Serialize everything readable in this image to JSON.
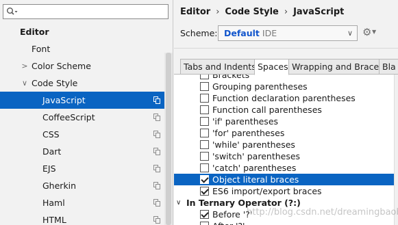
{
  "search": {
    "value": "",
    "icon": "search-dropdown-icon"
  },
  "tree": [
    {
      "label": "Editor",
      "level": 0,
      "bold": true
    },
    {
      "label": "Font",
      "level": 1
    },
    {
      "label": "Color Scheme",
      "level": 1,
      "arrow": ">"
    },
    {
      "label": "Code Style",
      "level": 1,
      "arrow": "∨"
    },
    {
      "label": "JavaScript",
      "level": 2,
      "selected": true,
      "copy_icon": true
    },
    {
      "label": "CoffeeScript",
      "level": 2,
      "copy_icon": true
    },
    {
      "label": "CSS",
      "level": 2,
      "copy_icon": true
    },
    {
      "label": "Dart",
      "level": 2,
      "copy_icon": true
    },
    {
      "label": "EJS",
      "level": 2,
      "copy_icon": true
    },
    {
      "label": "Gherkin",
      "level": 2,
      "copy_icon": true
    },
    {
      "label": "Haml",
      "level": 2,
      "copy_icon": true
    },
    {
      "label": "HTML",
      "level": 2,
      "copy_icon": true
    }
  ],
  "breadcrumb": {
    "items": [
      "Editor",
      "Code Style",
      "JavaScript"
    ],
    "separator": "›"
  },
  "scheme": {
    "label": "Scheme:",
    "name": "Default",
    "tag": "IDE",
    "chevron": "∨"
  },
  "tabs": [
    {
      "label": "Tabs and Indents"
    },
    {
      "label": "Spaces",
      "active": true
    },
    {
      "label": "Wrapping and Braces"
    },
    {
      "label": "Bla"
    }
  ],
  "options": [
    {
      "label": "Brackets",
      "checked": false
    },
    {
      "label": "Grouping parentheses",
      "checked": false
    },
    {
      "label": "Function declaration parentheses",
      "checked": false
    },
    {
      "label": "Function call parentheses",
      "checked": false
    },
    {
      "label": "'if' parentheses",
      "checked": false
    },
    {
      "label": "'for' parentheses",
      "checked": false
    },
    {
      "label": "'while' parentheses",
      "checked": false
    },
    {
      "label": "'switch' parentheses",
      "checked": false
    },
    {
      "label": "'catch' parentheses",
      "checked": false
    },
    {
      "label": "Object literal braces",
      "checked": true,
      "selected": true
    },
    {
      "label": "ES6 import/export braces",
      "checked": true
    },
    {
      "label": "In Ternary Operator (?:)",
      "group": true,
      "arrow": "∨"
    },
    {
      "label": "Before '?'",
      "checked": true
    },
    {
      "label": "After '?'",
      "checked": false
    }
  ],
  "watermark": "http://blog.csdn.net/dreamingbaobei3",
  "colors": {
    "selection": "#0a64c2",
    "scheme_name": "#1155cc",
    "panel_bg": "#f2f2f2"
  }
}
